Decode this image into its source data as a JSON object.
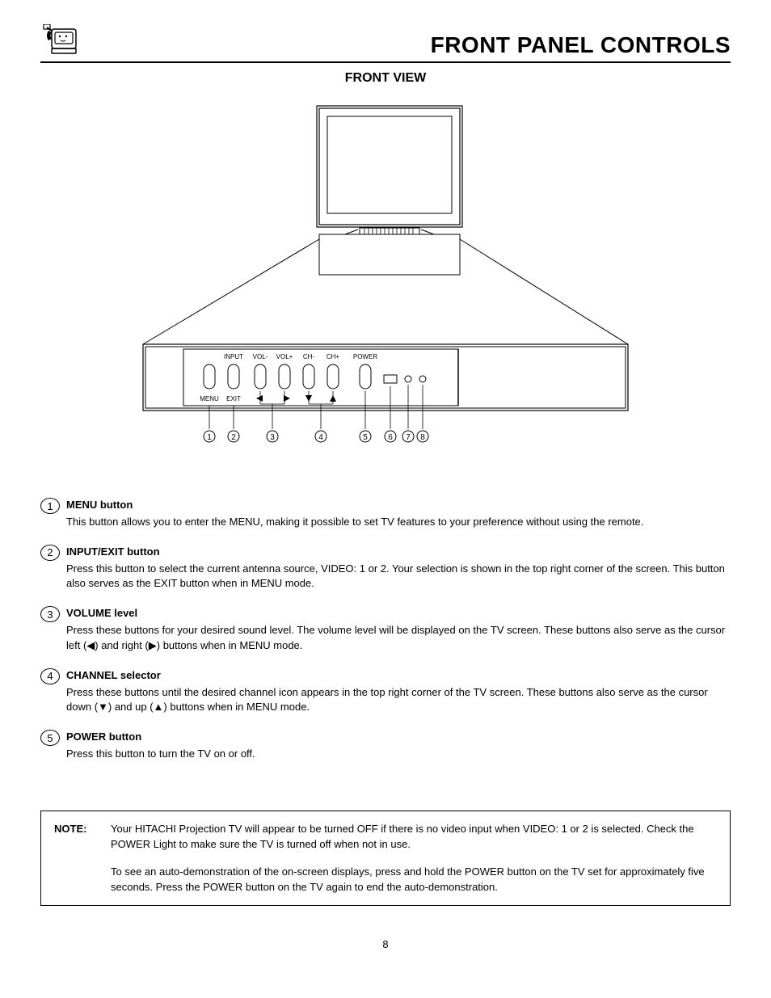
{
  "header": {
    "title": "FRONT PANEL CONTROLS"
  },
  "subtitle": "FRONT VIEW",
  "diagram": {
    "button_labels_top": [
      "INPUT",
      "VOL-",
      "VOL+",
      "CH-",
      "CH+",
      "POWER"
    ],
    "button_labels_bottom": [
      "MENU",
      "EXIT"
    ],
    "arrow_glyphs": [
      "◀",
      "▶",
      "▼",
      "▲"
    ],
    "callout_numbers": [
      "1",
      "2",
      "3",
      "4",
      "5",
      "6",
      "7",
      "8"
    ]
  },
  "items": [
    {
      "num": "1",
      "title": "MENU button",
      "desc": "This button allows you to enter the MENU, making it possible to set TV features to your preference without using the remote."
    },
    {
      "num": "2",
      "title": "INPUT/EXIT button",
      "desc": "Press this button to select the current antenna source, VIDEO: 1 or 2.  Your selection is shown in the top right corner of the screen. This button also serves as the EXIT button when in MENU mode."
    },
    {
      "num": "3",
      "title": "VOLUME level",
      "desc": "Press these buttons for your desired sound level.  The volume level will be displayed on the TV screen.  These buttons also serve as the cursor left (◀) and right (▶) buttons when in MENU mode."
    },
    {
      "num": "4",
      "title": "CHANNEL selector",
      "desc": "Press these buttons until the desired channel icon appears in the top right corner of the TV screen.  These buttons also serve as the cursor down (▼) and up (▲) buttons when in MENU mode."
    },
    {
      "num": "5",
      "title": "POWER button",
      "desc": "Press this button to turn the TV on or off."
    }
  ],
  "note": {
    "label": "NOTE:",
    "para1": "Your HITACHI Projection TV will appear to be turned OFF if there is no video input when VIDEO: 1 or 2 is selected. Check the POWER Light to make sure the TV is turned off when not in use.",
    "para2": "To see an auto-demonstration of the on-screen displays, press and hold the POWER button on the TV set for approximately five seconds.  Press the POWER button on the TV again to end the auto-demonstration."
  },
  "page_number": "8"
}
